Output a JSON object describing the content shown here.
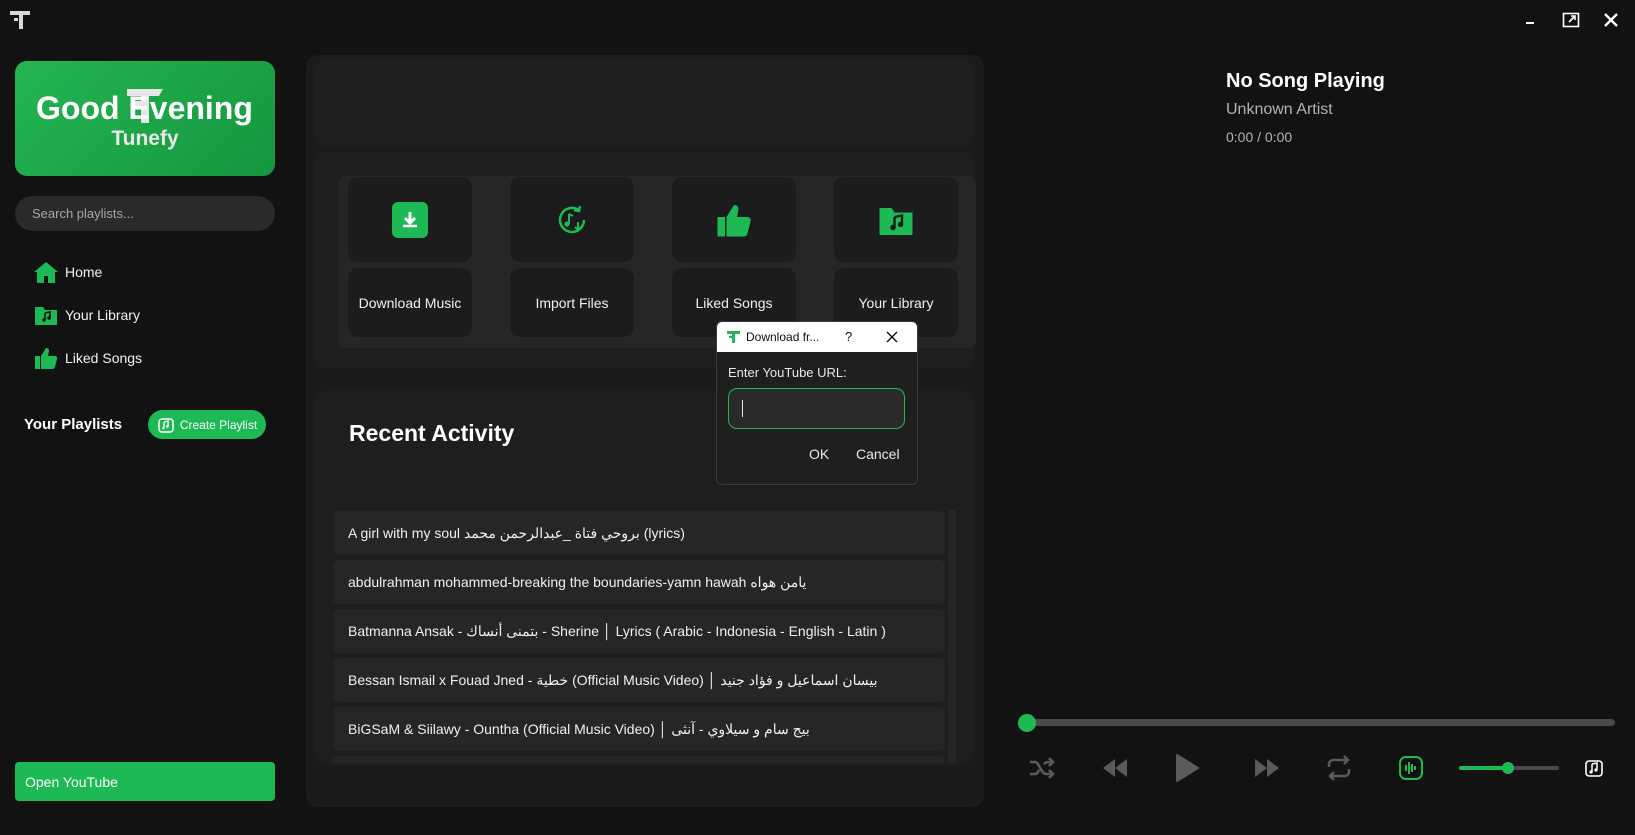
{
  "colors": {
    "accent": "#1db954",
    "background": "#121212",
    "panel": "#1b1b1b",
    "tile": "#262626"
  },
  "titlebar": {
    "icons": [
      "tunefy-logo-icon",
      "minimize-icon",
      "maximize-icon",
      "close-icon"
    ]
  },
  "sidebar": {
    "logo_text": "Tunefy",
    "search_placeholder": "Search playlists...",
    "nav": [
      {
        "label": "Home",
        "icon": "home-icon"
      },
      {
        "label": "Your Library",
        "icon": "library-folder-icon"
      },
      {
        "label": "Liked Songs",
        "icon": "thumbs-up-icon"
      }
    ],
    "playlists_title": "Your Playlists",
    "create_playlist_label": "Create Playlist",
    "open_youtube_label": "Open YouTube"
  },
  "main": {
    "greeting": "Good Evening",
    "actions": [
      {
        "label": "Download Music",
        "icon": "download-icon"
      },
      {
        "label": "Import Files",
        "icon": "import-music-icon"
      },
      {
        "label": "Liked Songs",
        "icon": "thumbs-up-icon"
      },
      {
        "label": "Your Library",
        "icon": "library-folder-icon"
      }
    ],
    "recent_title": "Recent Activity",
    "recent_items": [
      "A girl with my soul بروحي فتاة _عبدالرحمن محمد (lyrics)",
      "abdulrahman mohammed-breaking the boundaries-yamn hawah يامن هواه",
      "Batmanna Ansak - بتمنى أنساك - Sherine │ Lyrics ( Arabic - Indonesia - English - Latin )",
      "Bessan Ismail x Fouad Jned - خطية (Official Music Video) │ بيسان اسماعيل و فؤاد جنيد",
      "BiGSaM & Siilawy - Ountha (Official Music Video) │ بيج سام و سيلاوي - آنثى",
      ""
    ]
  },
  "player": {
    "title": "No Song Playing",
    "artist": "Unknown Artist",
    "time": "0:00 / 0:00",
    "progress": 0,
    "volume": 0.5,
    "controls": [
      "shuffle-icon",
      "previous-icon",
      "play-icon",
      "next-icon",
      "repeat-icon",
      "equalizer-icon",
      "volume-icon"
    ]
  },
  "dialog": {
    "title": "Download fr...",
    "help": "?",
    "label": "Enter YouTube URL:",
    "input_value": "",
    "ok_label": "OK",
    "cancel_label": "Cancel"
  }
}
